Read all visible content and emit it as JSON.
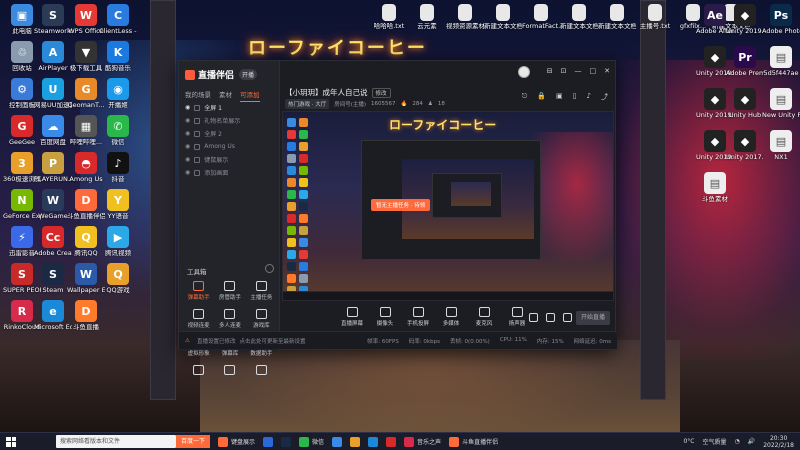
{
  "desktop_icons_left": [
    {
      "label": "此电脑",
      "color": "#3a8adf",
      "glyph": "▣"
    },
    {
      "label": "Steamworks Common...",
      "color": "#2b3b55",
      "glyph": "S"
    },
    {
      "label": "WPS Office",
      "color": "#e53935",
      "glyph": "W"
    },
    {
      "label": "ClientLess - 快捷方式",
      "color": "#2a7be0",
      "glyph": "C"
    },
    {
      "label": "回收站",
      "color": "#8a9bb0",
      "glyph": "♲"
    },
    {
      "label": "AirPlayer",
      "color": "#2a8ad8",
      "glyph": "A"
    },
    {
      "label": "极下载工具",
      "color": "#333",
      "glyph": "▼"
    },
    {
      "label": "酷狗音乐",
      "color": "#1a7ae0",
      "glyph": "K"
    },
    {
      "label": "控制面板",
      "color": "#3a7ad8",
      "glyph": "⚙"
    },
    {
      "label": "网易UU加速器",
      "color": "#1aa0e0",
      "glyph": "U"
    },
    {
      "label": "GeomanT...",
      "color": "#e88a2a",
      "glyph": "G"
    },
    {
      "label": "开播姬",
      "color": "#1a9ae8",
      "glyph": "◉"
    },
    {
      "label": "GeeGee",
      "color": "#d82a2a",
      "glyph": "G"
    },
    {
      "label": "百度网盘",
      "color": "#3a8ae8",
      "glyph": "☁"
    },
    {
      "label": "哔哩哔哩...",
      "color": "#555",
      "glyph": "▦"
    },
    {
      "label": "微信",
      "color": "#2ab84a",
      "glyph": "✆"
    },
    {
      "label": "360极速浏览器",
      "color": "#e8a02a",
      "glyph": "3"
    },
    {
      "label": "PLAYERUN... BATTLEGR...",
      "color": "#c8a040",
      "glyph": "P"
    },
    {
      "label": "Among Us",
      "color": "#d82a2a",
      "glyph": "◓"
    },
    {
      "label": "抖音",
      "color": "#111",
      "glyph": "♪"
    },
    {
      "label": "GeForce Experience",
      "color": "#76b900",
      "glyph": "N"
    },
    {
      "label": "WeGame",
      "color": "#2a3a5a",
      "glyph": "W"
    },
    {
      "label": "斗鱼直播伴侣",
      "color": "#ff6a3a",
      "glyph": "D"
    },
    {
      "label": "YY语音",
      "color": "#f0c020",
      "glyph": "Y"
    },
    {
      "label": "迅雷影音",
      "color": "#3a6ae8",
      "glyph": "⚡"
    },
    {
      "label": "Adobe Creat...",
      "color": "#d8282a",
      "glyph": "Cc"
    },
    {
      "label": "腾讯QQ",
      "color": "#f0c020",
      "glyph": "Q"
    },
    {
      "label": "腾讯视频",
      "color": "#2aa8e8",
      "glyph": "▶"
    },
    {
      "label": "SUPER PEOPLE CBT",
      "color": "#c82a2a",
      "glyph": "S"
    },
    {
      "label": "Steam",
      "color": "#1a2a44",
      "glyph": "S"
    },
    {
      "label": "Wallpaper Engine",
      "color": "#2a5aa8",
      "glyph": "W"
    },
    {
      "label": "QQ游戏",
      "color": "#e8a02a",
      "glyph": "Q"
    },
    {
      "label": "RinkoCloud",
      "color": "#d82a4a",
      "glyph": "R"
    },
    {
      "label": "Microsoft Edge",
      "color": "#1a8ad8",
      "glyph": "e"
    },
    {
      "label": "斗鱼直播",
      "color": "#ff7a2a",
      "glyph": "D"
    }
  ],
  "desktop_icons_top": [
    {
      "label": "哈哈哈.txt",
      "color": "#e8e8e8"
    },
    {
      "label": "云元素",
      "color": "#e8e8e8"
    },
    {
      "label": "视频资源素材",
      "color": "#e8e8e8"
    },
    {
      "label": "新建文本文档",
      "color": "#e8e8e8"
    },
    {
      "label": "FormatFact...",
      "color": "#e8e8e8"
    },
    {
      "label": "新建文本文档 (2).txt",
      "color": "#e8e8e8"
    },
    {
      "label": "新建文本文档 (3).txt",
      "color": "#e8e8e8"
    },
    {
      "label": "主播号.txt",
      "color": "#e8e8e8"
    },
    {
      "label": "gfxfilx...",
      "color": "#e8e8e8"
    },
    {
      "label": "新建文本文档 (4).txt",
      "color": "#e8e8e8"
    }
  ],
  "desktop_icons_right": [
    {
      "label": "Adobe After Effects",
      "color": "#2a1a4a",
      "glyph": "Ae"
    },
    {
      "label": "Unity 2019.4.7f1",
      "color": "#222",
      "glyph": "◆"
    },
    {
      "label": "Adobe Photosh...",
      "color": "#0a2a4a",
      "glyph": "Ps"
    },
    {
      "label": "Unity 2019.4.3...",
      "color": "#222",
      "glyph": "◆"
    },
    {
      "label": "Adobe Premiere...",
      "color": "#2a0a4a",
      "glyph": "Pr"
    },
    {
      "label": "5d5f447ae",
      "color": "#eee",
      "glyph": "▤"
    },
    {
      "label": "Unity 2019.4.12...",
      "color": "#222",
      "glyph": "◆"
    },
    {
      "label": "Unity Hub",
      "color": "#222",
      "glyph": "◆"
    },
    {
      "label": "New Unity Project",
      "color": "#eee",
      "glyph": "▤"
    },
    {
      "label": "Unity 2019.4.7...",
      "color": "#222",
      "glyph": "◆"
    },
    {
      "label": "Unity 2017.3.0...",
      "color": "#222",
      "glyph": "◆"
    },
    {
      "label": "NX1",
      "color": "#eee",
      "glyph": "▤"
    },
    {
      "label": "斗鱼素材",
      "color": "#eee",
      "glyph": "▤"
    }
  ],
  "app": {
    "name": "直播伴侣",
    "badge": "开播",
    "window_controls": [
      "⊟",
      "⊡",
      "—",
      "□",
      "✕"
    ]
  },
  "sidebar": {
    "tabs": [
      {
        "label": "我的场景",
        "active": false
      },
      {
        "label": "素材",
        "active": false
      },
      {
        "label": "可添加",
        "active": true
      }
    ],
    "scenes": [
      {
        "label": "全屏 1",
        "main": true
      },
      {
        "label": "礼物名单展示",
        "main": false
      },
      {
        "label": "全屏 2",
        "main": false
      },
      {
        "label": "Among Us",
        "main": false
      },
      {
        "label": "键鼠展示",
        "main": false
      },
      {
        "label": "添加画面",
        "main": false
      }
    ],
    "tools_title": "工具箱",
    "tools": [
      {
        "label": "弹幕助手",
        "orange": true
      },
      {
        "label": "房管助手",
        "orange": false
      },
      {
        "label": "主播任务",
        "orange": false
      },
      {
        "label": "视频连麦",
        "orange": false
      },
      {
        "label": "多人连麦",
        "orange": false
      },
      {
        "label": "游戏库",
        "orange": false
      },
      {
        "label": "虚拟形象",
        "orange": false
      },
      {
        "label": "弹幕库",
        "orange": false
      },
      {
        "label": "数据助手",
        "orange": false
      },
      {
        "label": "",
        "orange": false
      },
      {
        "label": "",
        "orange": false
      },
      {
        "label": "",
        "orange": false
      }
    ]
  },
  "room": {
    "title": "【小玥玥】成年人自己说",
    "edit_label": "修改",
    "category": "热门游戏 · 大厅",
    "room_id_label": "房间号(主播)",
    "room_id": "1605567",
    "heat": "284",
    "fans": "18"
  },
  "preview": {
    "sign_text": "ローファイコーヒー",
    "toast": "暂无主播任务 · 待领"
  },
  "bottom_tools": [
    {
      "label": "直播屏幕"
    },
    {
      "label": "摄像头"
    },
    {
      "label": "手机投屏"
    },
    {
      "label": "多媒体"
    },
    {
      "label": "麦克风"
    },
    {
      "label": "扬声器"
    }
  ],
  "start_button": "开始直播",
  "status": {
    "warning": "直播设置已修改",
    "hint": "点击此处可更新至最新设置",
    "stats": [
      "帧率: 60FPS",
      "码率: 0kbps",
      "丢帧: 0(0.00%)",
      "CPU: 11%",
      "内存: 15%",
      "网络延迟: 0ms"
    ]
  },
  "taskbar": {
    "search_placeholder": "搜索网络看版本和文件",
    "search_button": "百度一下",
    "apps": [
      {
        "label": "键盘展示",
        "color": "#ff6a3a"
      },
      {
        "label": "",
        "color": "#2a6ad8"
      },
      {
        "label": "",
        "color": "#1a2a44"
      },
      {
        "label": "微信",
        "color": "#2ab84a"
      },
      {
        "label": "",
        "color": "#3a8ae8"
      },
      {
        "label": "",
        "color": "#e8a02a"
      },
      {
        "label": "",
        "color": "#1a8ad8"
      },
      {
        "label": "",
        "color": "#d82a2a"
      },
      {
        "label": "音乐之声",
        "color": "#d82a4a"
      },
      {
        "label": "斗鱼直播伴侣",
        "color": "#ff6a3a"
      }
    ],
    "temperature": "0°C",
    "weather": "空气质量",
    "time": "20:30",
    "date": "2022/2/18"
  },
  "colors": {
    "accent": "#ff6a3a",
    "window_bg": "#1c1d22",
    "sidebar_bg": "#232429"
  }
}
